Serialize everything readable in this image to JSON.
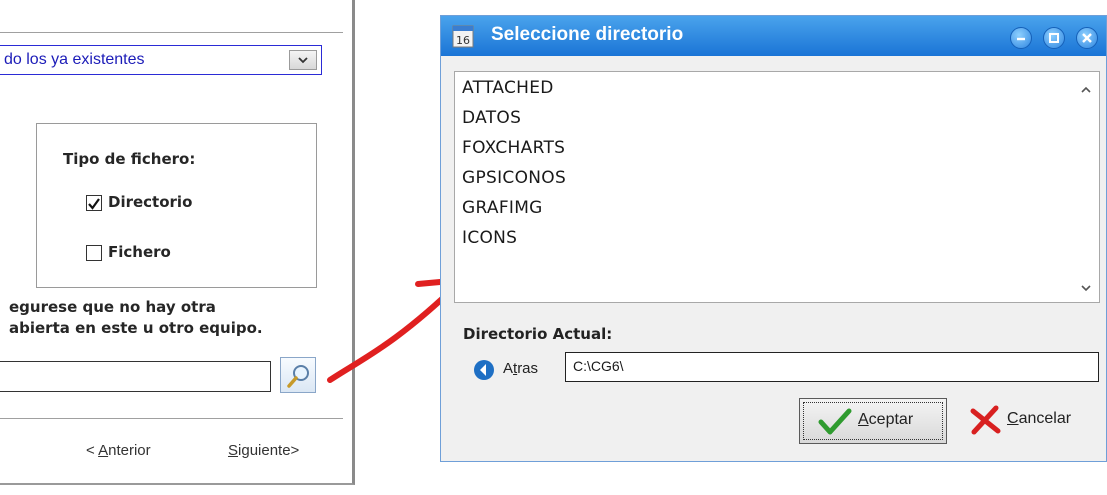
{
  "wizard": {
    "combo_value": "do los ya existentes",
    "file_type_label": "Tipo de fichero:",
    "options": [
      {
        "label": "Directorio",
        "checked": true
      },
      {
        "label": "Fichero",
        "checked": false
      }
    ],
    "warning_line1": "egurese que no hay otra",
    "warning_line2": "abierta en este u otro equipo.",
    "search_value": "",
    "prev_label_accel": "A",
    "prev_label_prefix": "< ",
    "prev_label_rest": "nterior",
    "next_label_accel": "S",
    "next_label_rest": "iguiente>"
  },
  "dialog": {
    "title": "Seleccione directorio",
    "directories": [
      "ATTACHED",
      "DATOS",
      "FOXCHARTS",
      "GPSICONOS",
      "GRAFIMG",
      "ICONS"
    ],
    "current_dir_label": "Directorio Actual:",
    "back_accel": "t",
    "back_prefix": "A",
    "back_rest": "ras",
    "current_path": "C:\\CG6\\",
    "ok_accel": "A",
    "ok_rest": "ceptar",
    "cancel_accel": "C",
    "cancel_rest": "ancelar"
  },
  "colors": {
    "titlebar": "#1a74d6",
    "arrow": "#e02020",
    "combo_text": "#1c1cb8"
  }
}
